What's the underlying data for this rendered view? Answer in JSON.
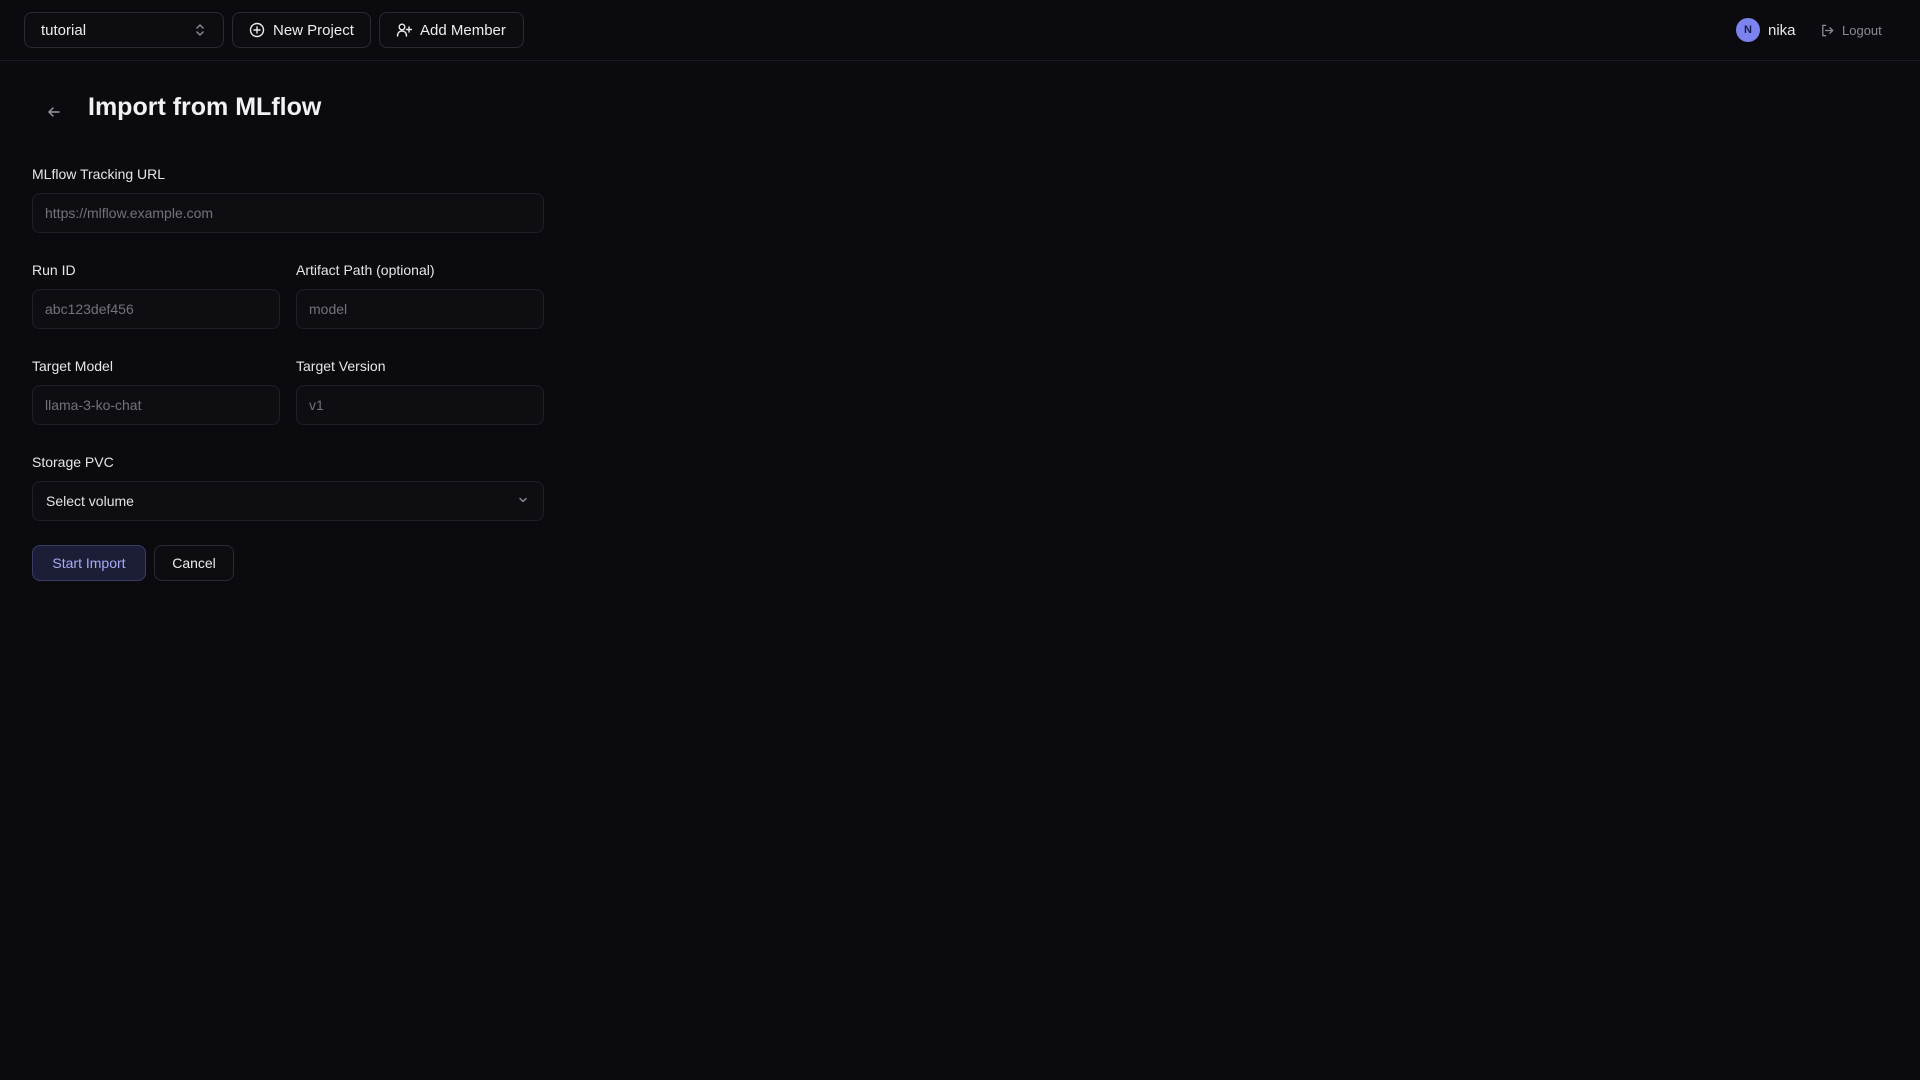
{
  "header": {
    "project": "tutorial",
    "new_project_label": "New Project",
    "add_member_label": "Add Member",
    "user_initial": "N",
    "user_name": "nika",
    "logout_label": "Logout"
  },
  "page": {
    "title": "Import from MLflow"
  },
  "form": {
    "tracking_url": {
      "label": "MLflow Tracking URL",
      "placeholder": "https://mlflow.example.com",
      "value": ""
    },
    "run_id": {
      "label": "Run ID",
      "placeholder": "abc123def456",
      "value": ""
    },
    "artifact_path": {
      "label": "Artifact Path (optional)",
      "placeholder": "model",
      "value": ""
    },
    "target_model": {
      "label": "Target Model",
      "placeholder": "llama-3-ko-chat",
      "value": ""
    },
    "target_version": {
      "label": "Target Version",
      "placeholder": "v1",
      "value": ""
    },
    "storage_pvc": {
      "label": "Storage PVC",
      "selected": "Select volume"
    },
    "start_label": "Start Import",
    "cancel_label": "Cancel"
  },
  "icons": {
    "project_select": "chevron-up-down-icon",
    "new_project": "plus-circle-icon",
    "add_member": "user-plus-icon",
    "logout": "logout-icon",
    "back": "arrow-left-icon",
    "select": "chevron-down-icon"
  },
  "colors": {
    "background": "#0b0b0f",
    "accent": "#7c83ee",
    "primary_button_text": "#a5acf5"
  }
}
